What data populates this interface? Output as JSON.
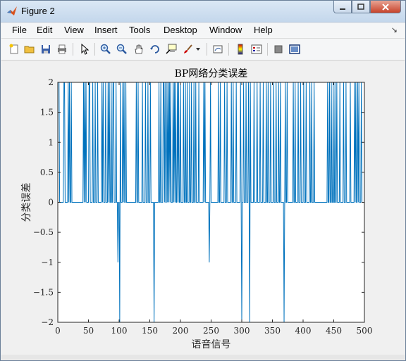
{
  "window": {
    "title": "Figure 2"
  },
  "menu": [
    "File",
    "Edit",
    "View",
    "Insert",
    "Tools",
    "Desktop",
    "Window",
    "Help"
  ],
  "toolbar_icons": [
    "new-figure-icon",
    "open-folder-icon",
    "save-icon",
    "print-icon",
    "pointer-icon",
    "zoom-in-icon",
    "zoom-out-icon",
    "pan-hand-icon",
    "rotate-3d-icon",
    "data-cursor-icon",
    "brush-icon",
    "dropdown-arrow-icon",
    "link-plot-icon",
    "colorbar-icon",
    "legend-icon",
    "hide-plot-tools-icon",
    "show-plot-tools-icon"
  ],
  "chart_data": {
    "type": "line",
    "title": "BP网络分类误差",
    "xlabel": "语音信号",
    "ylabel": "分类误差",
    "xlim": [
      0,
      500
    ],
    "ylim": [
      -2,
      2
    ],
    "xticks": [
      0,
      50,
      100,
      150,
      200,
      250,
      300,
      350,
      400,
      450,
      500
    ],
    "yticks": [
      -2,
      -1.5,
      -1,
      -0.5,
      0,
      0.5,
      1,
      1.5,
      2
    ],
    "xtick_labels": [
      "0",
      "50",
      "100",
      "150",
      "200",
      "250",
      "300",
      "350",
      "400",
      "450",
      "500"
    ],
    "ytick_labels": [
      "−2",
      "−1.5",
      "−1",
      "−0.5",
      "0",
      "0.5",
      "1",
      "1.5",
      "2"
    ],
    "line_color": "#0072bd",
    "series": [
      {
        "positive_error_2": [
          1,
          2,
          10,
          11,
          17,
          19,
          22,
          42,
          44,
          46,
          51,
          52,
          57,
          61,
          65,
          72,
          74,
          78,
          82,
          84,
          87,
          90,
          91,
          95,
          98,
          102,
          106,
          108,
          111,
          128,
          131,
          138,
          143,
          147,
          151,
          165,
          168,
          172,
          173,
          175,
          178,
          180,
          182,
          184,
          188,
          190,
          192,
          195,
          197,
          200,
          205,
          208,
          211,
          215,
          218,
          222,
          225,
          230,
          238,
          240,
          249,
          262,
          265,
          272,
          276,
          283,
          286,
          291,
          298,
          303,
          307,
          311,
          314,
          320,
          325,
          330,
          335,
          340,
          343,
          347,
          352,
          356,
          360,
          363,
          371,
          374,
          384,
          387,
          392,
          396,
          401,
          405,
          411,
          414,
          418,
          440,
          443,
          446,
          449,
          452,
          455,
          460,
          466,
          470,
          477,
          484,
          486,
          489,
          491,
          495
        ],
        "negative_error_2": [
          101,
          157,
          300,
          313,
          369
        ],
        "negative_error_1": [
          98,
          247
        ]
      }
    ]
  }
}
